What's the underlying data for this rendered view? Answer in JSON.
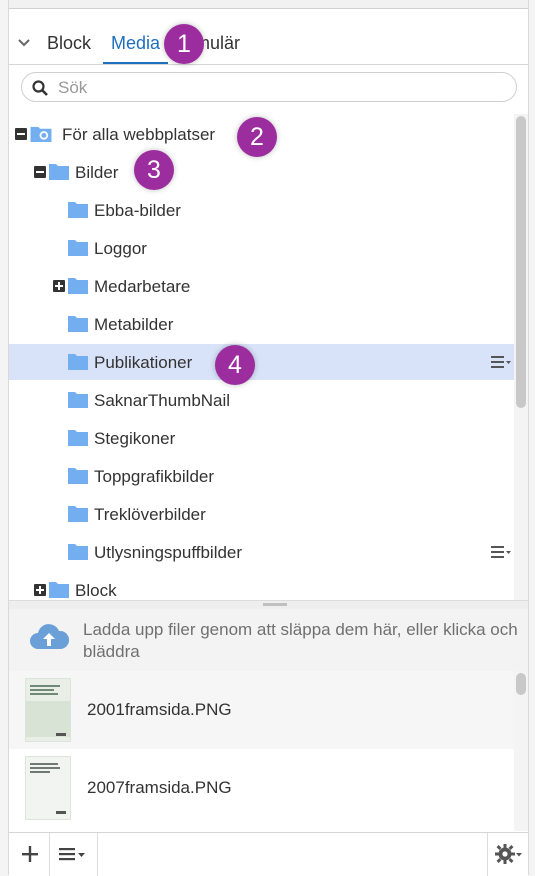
{
  "tabs": [
    {
      "label": "Block"
    },
    {
      "label": "Media"
    },
    {
      "label": "mulär"
    }
  ],
  "search": {
    "placeholder": "Sök"
  },
  "tree": [
    {
      "label": "För alla webbplatser",
      "expander": "minus"
    },
    {
      "label": "Bilder",
      "expander": "minus"
    },
    {
      "label": "Ebba-bilder"
    },
    {
      "label": "Loggor"
    },
    {
      "label": "Medarbetare",
      "expander": "plus"
    },
    {
      "label": "Metabilder"
    },
    {
      "label": "Publikationer",
      "selected": true
    },
    {
      "label": "SaknarThumbNail"
    },
    {
      "label": "Stegikoner"
    },
    {
      "label": "Toppgrafikbilder"
    },
    {
      "label": "Treklöverbilder"
    },
    {
      "label": "Utlysningspuffbilder"
    },
    {
      "label": "Block",
      "expander": "plus"
    }
  ],
  "upload": {
    "text": "Ladda upp filer genom att släppa dem här, eller klicka och bläddra"
  },
  "files": [
    {
      "name": "2001framsida.PNG"
    },
    {
      "name": "2007framsida.PNG"
    }
  ],
  "callouts": [
    "1",
    "2",
    "3",
    "4"
  ],
  "colors": {
    "accent": "#1f6fbf",
    "folder": "#72aef0",
    "callout": "#9b2d9f",
    "selected_row": "#d8e2f8"
  }
}
